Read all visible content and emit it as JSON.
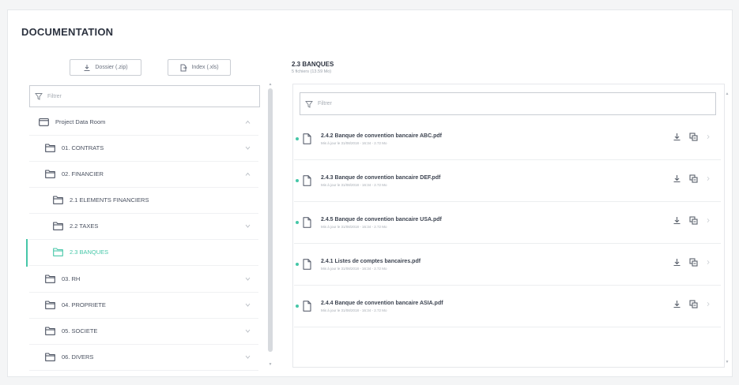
{
  "page": {
    "title": "DOCUMENTATION"
  },
  "toolbar": {
    "dossier_label": "Dossier (.zip)",
    "index_label": "Index (.xls)"
  },
  "left_filter": {
    "placeholder": "Filtrer"
  },
  "tree": [
    {
      "label": "Project Data Room",
      "level": 0,
      "icon": "folder-root-icon",
      "chevron": "up",
      "active": false
    },
    {
      "label": "01. CONTRATS",
      "level": 1,
      "icon": "folder-icon",
      "chevron": "down",
      "active": false
    },
    {
      "label": "02. FINANCIER",
      "level": 1,
      "icon": "folder-icon",
      "chevron": "up",
      "active": false
    },
    {
      "label": "2.1 ELEMENTS FINANCIERS",
      "level": 2,
      "icon": "folder-icon",
      "chevron": "",
      "active": false
    },
    {
      "label": "2.2 TAXES",
      "level": 2,
      "icon": "folder-icon",
      "chevron": "down",
      "active": false
    },
    {
      "label": "2.3 BANQUES",
      "level": 2,
      "icon": "folder-icon",
      "chevron": "",
      "active": true
    },
    {
      "label": "03. RH",
      "level": 1,
      "icon": "folder-icon",
      "chevron": "down",
      "active": false
    },
    {
      "label": "04. PROPRIETE",
      "level": 1,
      "icon": "folder-icon",
      "chevron": "down",
      "active": false
    },
    {
      "label": "05. SOCIETE",
      "level": 1,
      "icon": "folder-icon",
      "chevron": "down",
      "active": false
    },
    {
      "label": "06. DIVERS",
      "level": 1,
      "icon": "folder-icon",
      "chevron": "down",
      "active": false
    }
  ],
  "folder": {
    "title": "2.3 BANQUES",
    "subtitle": "5 fichiers (13.59 Mo)"
  },
  "right_filter": {
    "placeholder": "Filtrer"
  },
  "files": [
    {
      "name": "2.4.2 Banque de convention bancaire ABC.pdf",
      "meta": "Mis à jour le 31/08/2018 - 16:34 - 2.72 Mo"
    },
    {
      "name": "2.4.3 Banque de convention bancaire DEF.pdf",
      "meta": "Mis à jour le 31/08/2018 - 16:34 - 2.72 Mo"
    },
    {
      "name": "2.4.5 Banque de convention bancaire USA.pdf",
      "meta": "Mis à jour le 31/08/2018 - 16:34 - 2.72 Mo"
    },
    {
      "name": "2.4.1 Listes de comptes bancaires.pdf",
      "meta": "Mis à jour le 31/08/2018 - 16:34 - 2.72 Mo"
    },
    {
      "name": "2.4.4 Banque de convention bancaire ASIA.pdf",
      "meta": "Mis à jour le 31/08/2018 - 16:34 - 2.72 Mo"
    }
  ],
  "colors": {
    "accent": "#46c7a8",
    "text": "#3d4451",
    "muted": "#a5abb3",
    "border": "#c9cdd3",
    "background": "#f4f5f6"
  }
}
